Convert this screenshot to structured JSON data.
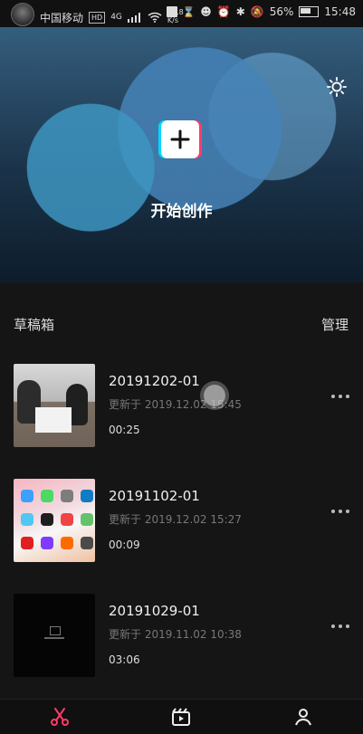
{
  "status": {
    "carrier": "中国移动",
    "hd": "HD",
    "network": "4G",
    "speed_top": "36.8",
    "speed_bottom": "K/s",
    "battery": "56%",
    "time": "15:48"
  },
  "hero": {
    "create_label": "开始创作",
    "plus_icon": "plus-icon",
    "settings_icon": "gear-icon"
  },
  "drafts": {
    "title": "草稿箱",
    "manage": "管理",
    "items": [
      {
        "title": "20191202-01",
        "meta": "更新于 2019.12.02 15:45",
        "duration": "00:25"
      },
      {
        "title": "20191102-01",
        "meta": "更新于 2019.12.02 15:27",
        "duration": "00:09"
      },
      {
        "title": "20191029-01",
        "meta": "更新于 2019.11.02 10:38",
        "duration": "03:06"
      }
    ]
  },
  "nav": {
    "icons": [
      "scissors-icon",
      "clapperboard-icon",
      "person-icon"
    ]
  }
}
